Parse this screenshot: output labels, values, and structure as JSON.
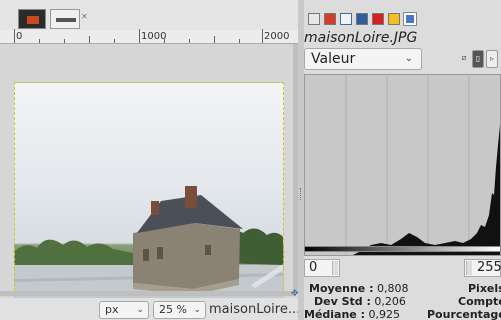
{
  "ruler": {
    "labels": [
      "0",
      "1000",
      "2000"
    ]
  },
  "statusbar": {
    "unit": "px",
    "zoom": "25 %",
    "filename": "maisonLoire..."
  },
  "histogram_dock": {
    "image_title": "maisonLoire.JPG",
    "channel": "Valeur",
    "range_start": "0",
    "range_end": "255",
    "stats": [
      {
        "label": "Moyenne :",
        "value": "0,808"
      },
      {
        "label": "Dev Std :",
        "value": "0,206"
      },
      {
        "label": "Médiane :",
        "value": "0,925"
      }
    ],
    "right_labels": [
      "Pixels",
      "Compte",
      "Pourcentage"
    ]
  },
  "colors": {
    "accent_nav": "#3a6ea5",
    "selection_border": "#c8c820",
    "histogram_fill": "#111111"
  },
  "icons": [
    "image-tab-thumbnail",
    "close-icon",
    "chevron-down-icon",
    "histogram-icon",
    "layers-icon",
    "paths-icon",
    "channels-icon",
    "undo-icon",
    "colors-icon",
    "navigate-icon"
  ]
}
